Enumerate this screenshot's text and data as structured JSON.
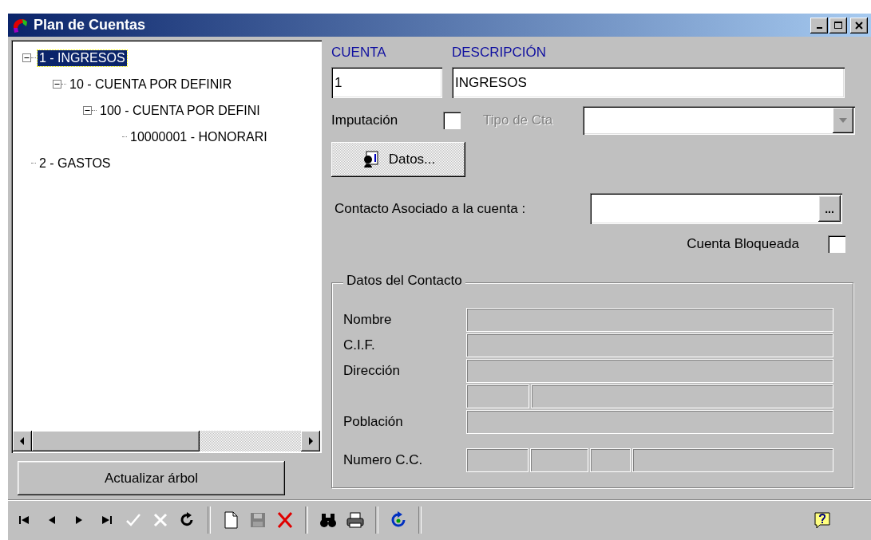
{
  "window": {
    "title": "Plan de Cuentas"
  },
  "tree": {
    "items": [
      {
        "label": "1 - INGRESOS",
        "selected": true,
        "expanded": true,
        "children": [
          {
            "label": "10 - CUENTA POR DEFINIR",
            "selected": false,
            "expanded": true,
            "children": [
              {
                "label": "100 - CUENTA POR DEFINI",
                "selected": false,
                "expanded": true,
                "children": [
                  {
                    "label": "10000001 - HONORARI",
                    "selected": false
                  }
                ]
              }
            ]
          }
        ]
      },
      {
        "label": "2 - GASTOS",
        "selected": false
      }
    ]
  },
  "refresh_button": "Actualizar árbol",
  "form": {
    "cuenta": {
      "label": "CUENTA",
      "value": "1"
    },
    "descripcion": {
      "label": "DESCRIPCIÓN",
      "value": "INGRESOS"
    },
    "imputacion": {
      "label": "Imputación",
      "checked": false
    },
    "tipo_cta": {
      "label": "Tipo de Cta",
      "disabled": true
    },
    "datos_button": "Datos...",
    "contacto": {
      "label": "Contacto Asociado a la cuenta :",
      "browse": "..."
    },
    "bloqueada": {
      "label": "Cuenta Bloqueada",
      "checked": false
    }
  },
  "contact_group": {
    "title": "Datos del Contacto",
    "rows": [
      {
        "label": "Nombre",
        "kind": "single"
      },
      {
        "label": "C.I.F.",
        "kind": "single"
      },
      {
        "label": "Dirección",
        "kind": "single"
      },
      {
        "kind": "split"
      },
      {
        "label": "Población",
        "kind": "single"
      },
      {
        "label": "Numero C.C.",
        "kind": "account"
      }
    ]
  },
  "toolbar": [
    {
      "kind": "first",
      "disabled": false
    },
    {
      "kind": "prev",
      "disabled": false
    },
    {
      "kind": "next",
      "disabled": false
    },
    {
      "kind": "last",
      "disabled": false
    },
    {
      "kind": "accept",
      "disabled": true
    },
    {
      "kind": "cancel",
      "disabled": true
    },
    {
      "kind": "redo",
      "disabled": false
    },
    {
      "kind": "separator"
    },
    {
      "kind": "new",
      "disabled": false
    },
    {
      "kind": "save",
      "disabled": true
    },
    {
      "kind": "delete",
      "disabled": false
    },
    {
      "kind": "separator"
    },
    {
      "kind": "find",
      "disabled": false
    },
    {
      "kind": "print",
      "disabled": false
    },
    {
      "kind": "separator"
    },
    {
      "kind": "refresh",
      "disabled": false
    },
    {
      "kind": "separator"
    },
    {
      "kind": "help",
      "disabled": false
    }
  ]
}
